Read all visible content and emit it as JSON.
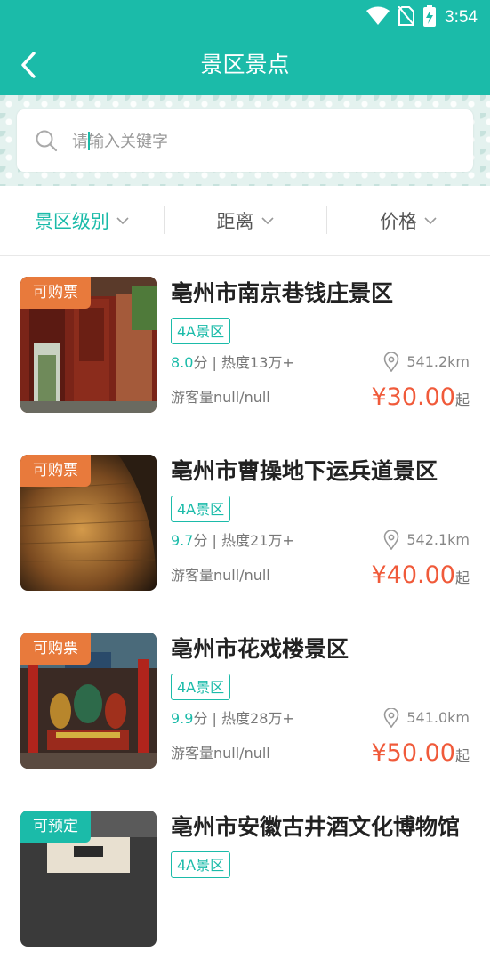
{
  "status_bar": {
    "time": "3:54"
  },
  "header": {
    "title": "景区景点"
  },
  "search": {
    "placeholder": "请输入关键字"
  },
  "filters": [
    {
      "label": "景区级别",
      "active": true
    },
    {
      "label": "距离",
      "active": false
    },
    {
      "label": "价格",
      "active": false
    }
  ],
  "colors": {
    "primary": "#1bbba9",
    "price": "#f05a3a",
    "tag_buy": "#e87a3c"
  },
  "spots": [
    {
      "tag": "可购票",
      "tag_type": "buy",
      "name": "亳州市南京巷钱庄景区",
      "level": "4A景区",
      "score": "8.0",
      "score_unit": "分",
      "heat": " | 热度13万+",
      "distance": "541.2km",
      "visitors": "游客量null/null",
      "price": "¥30.00",
      "price_suffix": "起",
      "image": "red wooden courtyard gate"
    },
    {
      "tag": "可购票",
      "tag_type": "buy",
      "name": "亳州市曹操地下运兵道景区",
      "level": "4A景区",
      "score": "9.7",
      "score_unit": "分",
      "heat": " | 热度21万+",
      "distance": "542.1km",
      "visitors": "游客量null/null",
      "price": "¥40.00",
      "price_suffix": "起",
      "image": "brick tunnel lit warm"
    },
    {
      "tag": "可购票",
      "tag_type": "buy",
      "name": "亳州市花戏楼景区",
      "level": "4A景区",
      "score": "9.9",
      "score_unit": "分",
      "heat": " | 热度28万+",
      "distance": "541.0km",
      "visitors": "游客量null/null",
      "price": "¥50.00",
      "price_suffix": "起",
      "image": "temple interior with statues"
    },
    {
      "tag": "可预定",
      "tag_type": "book",
      "name": "亳州市安徽古井酒文化博物馆",
      "level": "4A景区",
      "image": "museum building entrance"
    }
  ]
}
